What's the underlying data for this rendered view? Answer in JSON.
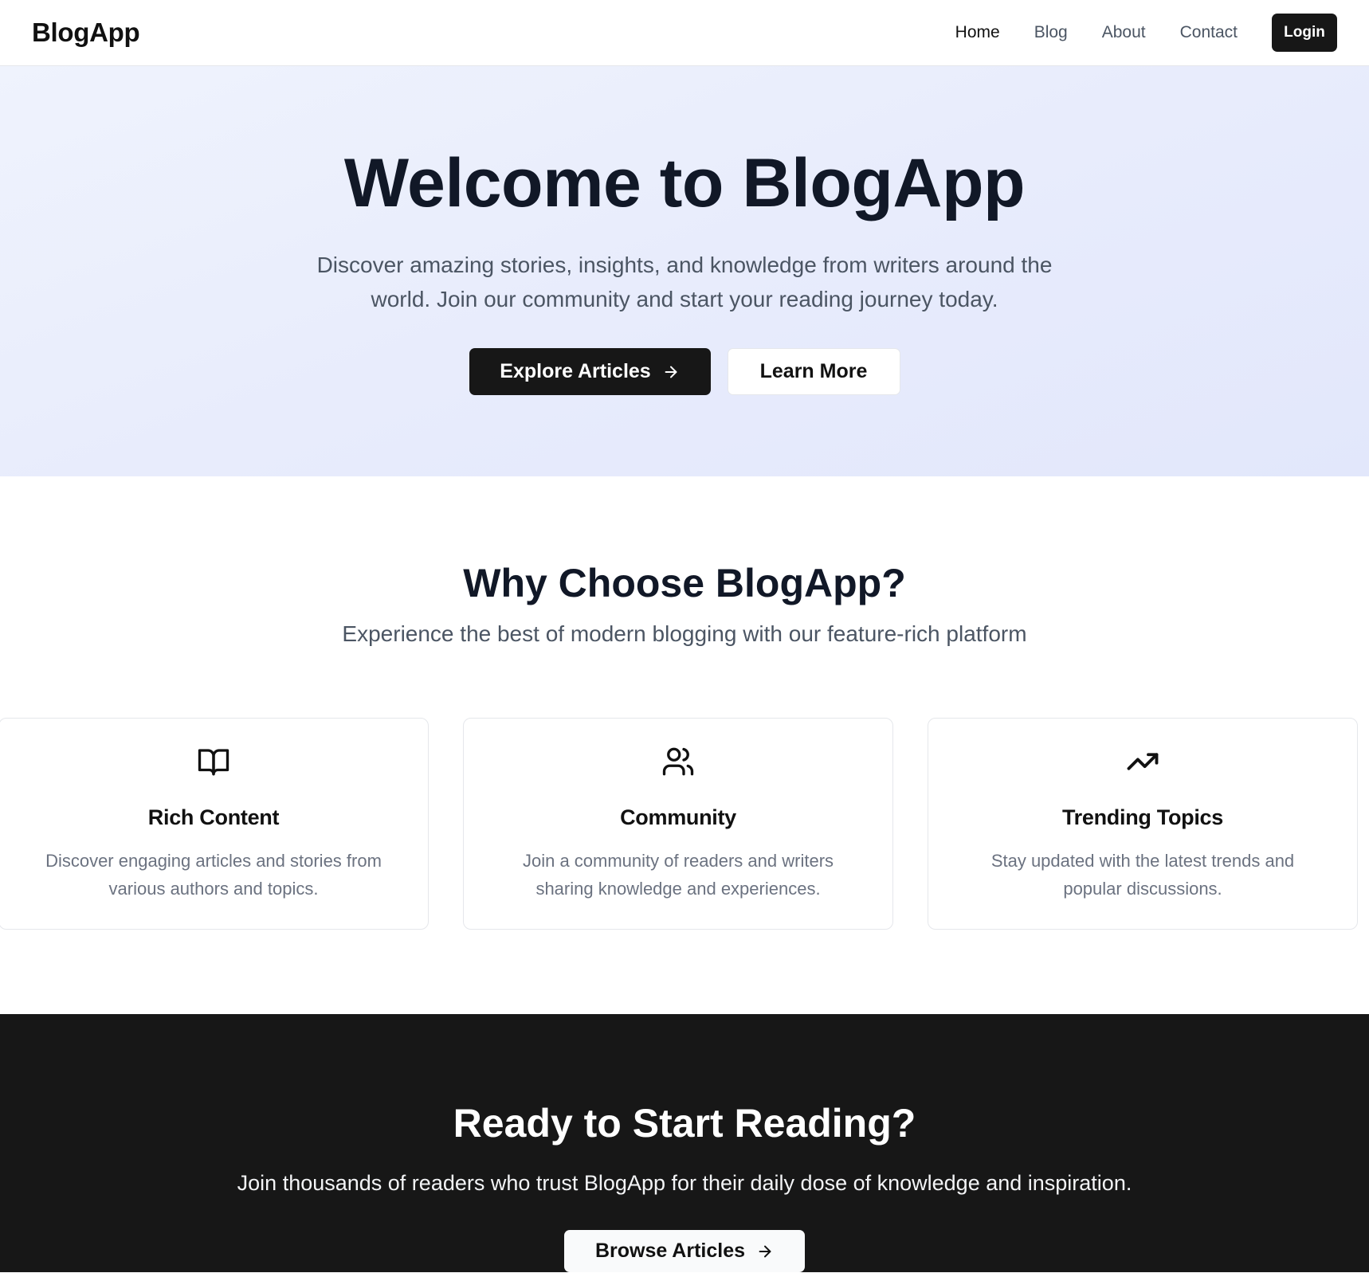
{
  "header": {
    "brand": "BlogApp",
    "nav": [
      {
        "label": "Home",
        "active": true
      },
      {
        "label": "Blog"
      },
      {
        "label": "About"
      },
      {
        "label": "Contact"
      }
    ],
    "login_label": "Login"
  },
  "hero": {
    "title": "Welcome to BlogApp",
    "subtitle": "Discover amazing stories, insights, and knowledge from writers around the world. Join our community and start your reading journey today.",
    "primary_label": "Explore Articles",
    "primary_icon": "arrow-right-icon",
    "secondary_label": "Learn More"
  },
  "features": {
    "title": "Why Choose BlogApp?",
    "subtitle": "Experience the best of modern blogging with our feature-rich platform",
    "cards": [
      {
        "icon": "book-open-icon",
        "title": "Rich Content",
        "description": "Discover engaging articles and stories from various authors and topics."
      },
      {
        "icon": "users-icon",
        "title": "Community",
        "description": "Join a community of readers and writers sharing knowledge and experiences."
      },
      {
        "icon": "trending-up-icon",
        "title": "Trending Topics",
        "description": "Stay updated with the latest trends and popular discussions."
      }
    ]
  },
  "cta": {
    "title": "Ready to Start Reading?",
    "subtitle": "Join thousands of readers who trust BlogApp for their daily dose of knowledge and inspiration.",
    "button_label": "Browse Articles",
    "button_icon": "arrow-right-icon"
  },
  "colors": {
    "primary": "#171717",
    "hero_bg_start": "#eff3fd",
    "hero_bg_end": "#e2e7fb",
    "text_muted": "#4b5563"
  }
}
